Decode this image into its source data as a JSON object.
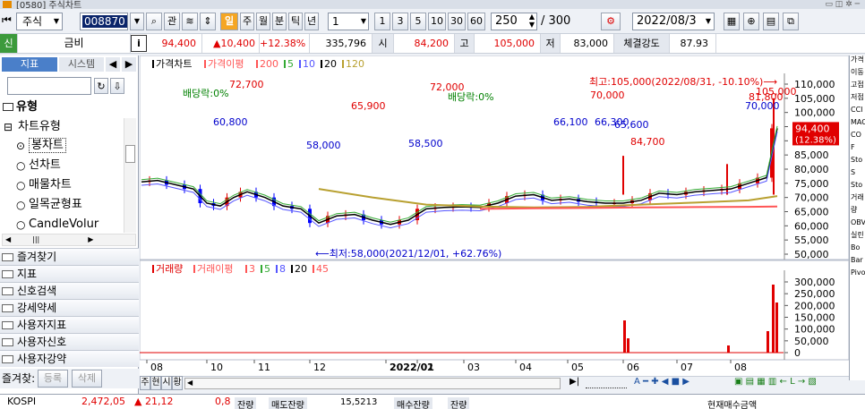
{
  "window": {
    "title": "[0580] 주식차트"
  },
  "toolbar": {
    "market": "주식",
    "code": "008870",
    "search_btn": "관",
    "period_badge": "일",
    "periods": [
      "주",
      "월",
      "분",
      "틱",
      "년"
    ],
    "interval": "1",
    "minute_buttons": [
      "1",
      "3",
      "5",
      "10",
      "30",
      "60"
    ],
    "count": "250",
    "total": "/ 300",
    "date": "2022/08/3"
  },
  "quote": {
    "badge": "신",
    "name": "금비",
    "info": "i",
    "price": "94,400",
    "change": "▲10,400",
    "rate": "+12.38%",
    "volume": "335,796",
    "open_label": "시",
    "open": "84,200",
    "high_label": "고",
    "high": "105,000",
    "low_label": "저",
    "low": "83,000",
    "strength_label": "체결강도",
    "strength": "87.93"
  },
  "sidebar": {
    "tabs": [
      "지표",
      "시스템"
    ],
    "group_title": "유형",
    "tree_title": "차트유형",
    "items": [
      "봉차트",
      "선차트",
      "매물차트",
      "일목균형표",
      "CandleVolur"
    ],
    "groups": [
      "즐겨찾기",
      "지표",
      "신호검색",
      "강세약세",
      "사용자지표",
      "사용자신호",
      "사용자강약"
    ],
    "fav_label": "즐겨찾:",
    "fav_add": "등록",
    "fav_del": "삭제",
    "view_btns": [
      "주",
      "현",
      "시",
      "황"
    ]
  },
  "price_chart": {
    "legend": [
      {
        "label": "가격차트",
        "color": "#000000"
      },
      {
        "label": "가격이평",
        "color": "#ff5555"
      },
      {
        "label": "200",
        "color": "#ff5555"
      },
      {
        "label": "5",
        "color": "#33aa33"
      },
      {
        "label": "10",
        "color": "#5555ff"
      },
      {
        "label": "20",
        "color": "#000000"
      },
      {
        "label": "120",
        "color": "#b8a030"
      }
    ],
    "y_ticks": [
      "110,000",
      "105,000",
      "100,000",
      "95,000",
      "90,000",
      "85,000",
      "80,000",
      "75,000",
      "70,000",
      "65,000",
      "60,000",
      "55,000",
      "50,000"
    ],
    "current_tag": "94,400",
    "current_rate": "(12.38%)",
    "max_note": "최고:105,000(2022/08/31, -10.10%)⟶",
    "max_label": "105,000",
    "min_note": "⟵최저:58,000(2021/12/01, +62.76%)",
    "annotations": [
      {
        "text": "배당락:0%",
        "color": "#008000"
      },
      {
        "text": "72,700",
        "color": "#e00000"
      },
      {
        "text": "60,800",
        "color": "#0000cc"
      },
      {
        "text": "65,900",
        "color": "#e00000"
      },
      {
        "text": "58,000",
        "color": "#0000cc"
      },
      {
        "text": "72,000",
        "color": "#e00000"
      },
      {
        "text": "배당락:0%",
        "color": "#008000"
      },
      {
        "text": "58,500",
        "color": "#0000cc"
      },
      {
        "text": "70,000",
        "color": "#e00000"
      },
      {
        "text": "66,100",
        "color": "#0000cc"
      },
      {
        "text": "66,300",
        "color": "#0000cc"
      },
      {
        "text": "84,700",
        "color": "#e00000"
      },
      {
        "text": "65,600",
        "color": "#0000cc"
      },
      {
        "text": "81,800",
        "color": "#e00000"
      },
      {
        "text": "70,000",
        "color": "#0000cc"
      }
    ]
  },
  "volume_chart": {
    "legend": [
      {
        "label": "거래량",
        "color": "#e00000"
      },
      {
        "label": "거래이평",
        "color": "#ff5555"
      },
      {
        "label": "3",
        "color": "#ff5555"
      },
      {
        "label": "5",
        "color": "#33aa33"
      },
      {
        "label": "8",
        "color": "#5555ff"
      },
      {
        "label": "20",
        "color": "#000000"
      },
      {
        "label": "45",
        "color": "#ff5555"
      }
    ],
    "y_ticks": [
      "300,000",
      "250,000",
      "200,000",
      "150,000",
      "100,000",
      "50,000",
      "0"
    ]
  },
  "x_axis": [
    "08",
    "10",
    "11",
    "12",
    "2022/01",
    "02",
    "03",
    "04",
    "05",
    "06",
    "07",
    "08"
  ],
  "right_panel": [
    "가격",
    "이동",
    "고점",
    "저점",
    "CCI",
    "MAC",
    "CO",
    "F",
    "Sto",
    "S",
    "Sto",
    "거래",
    "량",
    "OBV",
    "실린",
    "Bo",
    "Bar",
    "Pivo"
  ],
  "status": {
    "index_name": "KOSPI",
    "index_value": "2,472,05",
    "index_change": "▲ 21,12",
    "index_rate": "0,8",
    "ticker_items": [
      "잔량",
      "매도잔량",
      "15,5213",
      "매수잔량",
      "잔량"
    ],
    "right_text": "현재매수금액"
  },
  "colors": {
    "up": "#e00000",
    "down": "#0000ff",
    "accent": "#0a246a"
  }
}
